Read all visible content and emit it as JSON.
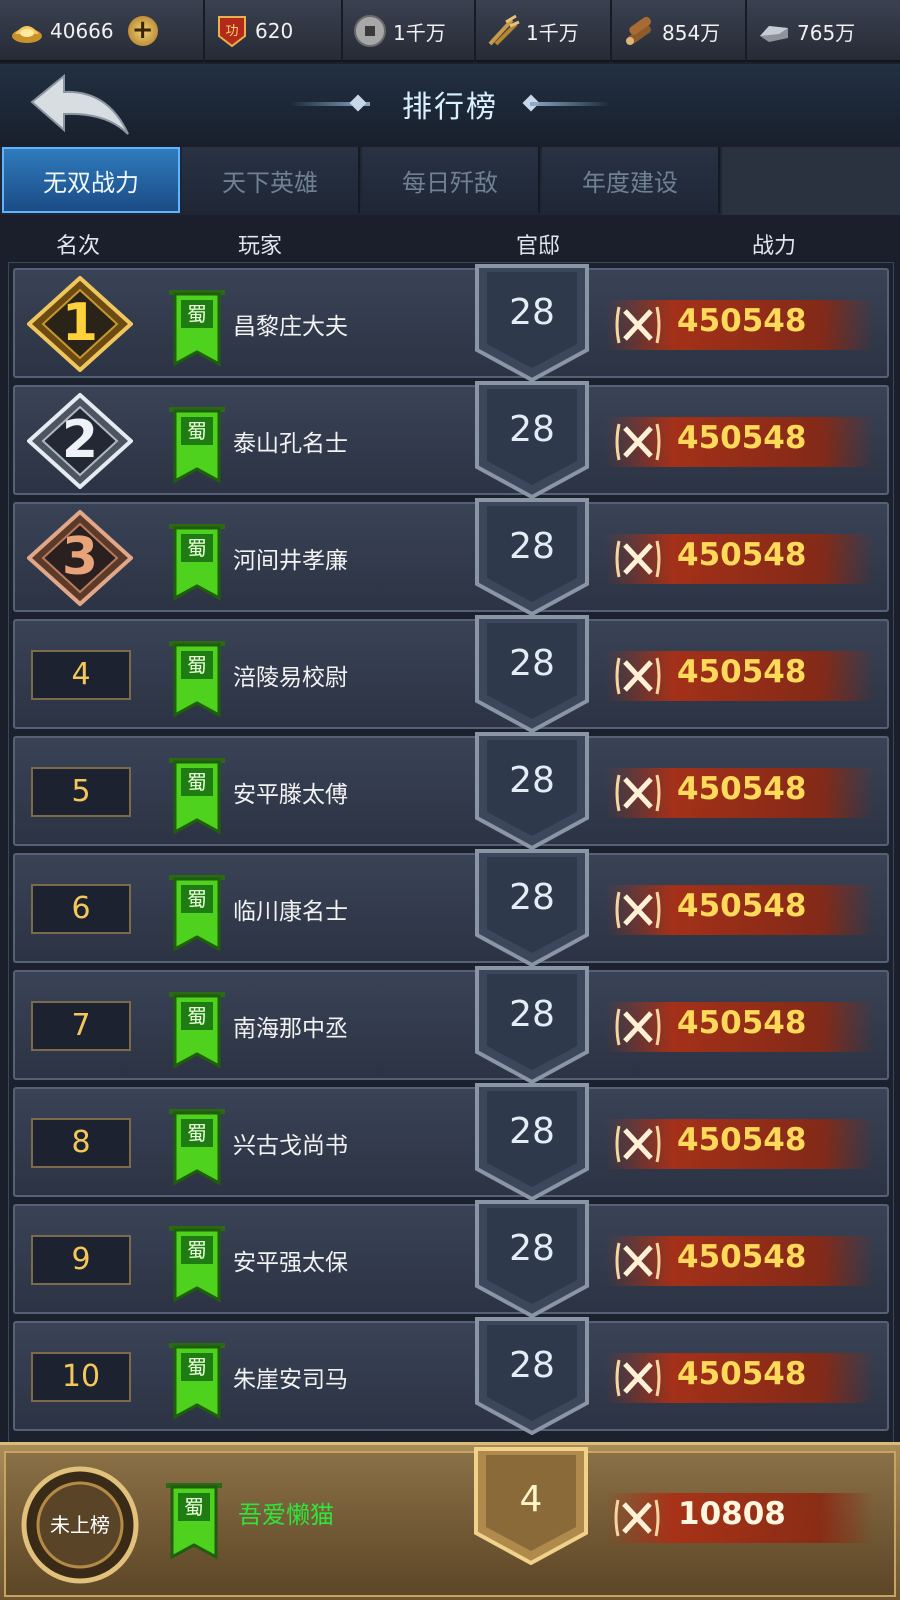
{
  "resources": [
    {
      "icon": "gold-ingot-icon",
      "value": "40666"
    },
    {
      "icon": "merit-badge-icon",
      "value": "620"
    },
    {
      "icon": "copper-coin-icon",
      "value": "1千万"
    },
    {
      "icon": "grain-icon",
      "value": "1千万"
    },
    {
      "icon": "wood-icon",
      "value": "854万"
    },
    {
      "icon": "iron-icon",
      "value": "765万"
    }
  ],
  "header": {
    "title": "排行榜"
  },
  "tabs": [
    {
      "label": "无双战力",
      "active": true
    },
    {
      "label": "天下英雄",
      "active": false
    },
    {
      "label": "每日歼敌",
      "active": false
    },
    {
      "label": "年度建设",
      "active": false
    }
  ],
  "columns": {
    "rank": "名次",
    "player": "玩家",
    "mansion": "官邸",
    "power": "战力"
  },
  "faction_label": "蜀",
  "rows": [
    {
      "rank": "1",
      "name": "昌黎庄大夫",
      "level": "28",
      "power": "450548"
    },
    {
      "rank": "2",
      "name": "泰山孔名士",
      "level": "28",
      "power": "450548"
    },
    {
      "rank": "3",
      "name": "河间井孝廉",
      "level": "28",
      "power": "450548"
    },
    {
      "rank": "4",
      "name": "涪陵易校尉",
      "level": "28",
      "power": "450548"
    },
    {
      "rank": "5",
      "name": "安平滕太傅",
      "level": "28",
      "power": "450548"
    },
    {
      "rank": "6",
      "name": "临川康名士",
      "level": "28",
      "power": "450548"
    },
    {
      "rank": "7",
      "name": "南海那中丞",
      "level": "28",
      "power": "450548"
    },
    {
      "rank": "8",
      "name": "兴古戈尚书",
      "level": "28",
      "power": "450548"
    },
    {
      "rank": "9",
      "name": "安平强太保",
      "level": "28",
      "power": "450548"
    },
    {
      "rank": "10",
      "name": "朱崖安司马",
      "level": "28",
      "power": "450548"
    }
  ],
  "self": {
    "rank_label": "未上榜",
    "name": "吾爱懒猫",
    "level": "4",
    "power": "10808"
  },
  "colors": {
    "accent": "#2f7bbd",
    "power": "#ffd95a",
    "self_name": "#2ee53a",
    "gold_rank": "#f3c75a"
  }
}
